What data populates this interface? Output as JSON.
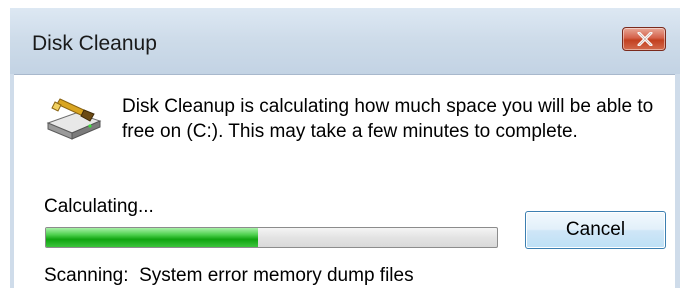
{
  "window": {
    "title": "Disk Cleanup",
    "close_icon": "close-icon"
  },
  "dialog": {
    "icon": "disk-cleanup-icon",
    "message": "Disk Cleanup is calculating how much space you will be able to free on  (C:). This may take a few minutes to complete.",
    "status_label": "Calculating...",
    "progress_fraction": 0.47,
    "cancel_label": "Cancel",
    "scanning_label": "Scanning:",
    "scanning_item": "System error memory dump files"
  },
  "colors": {
    "progress_green": "#10a410",
    "close_red": "#c2401f",
    "title_bar": "#cddbe9"
  }
}
